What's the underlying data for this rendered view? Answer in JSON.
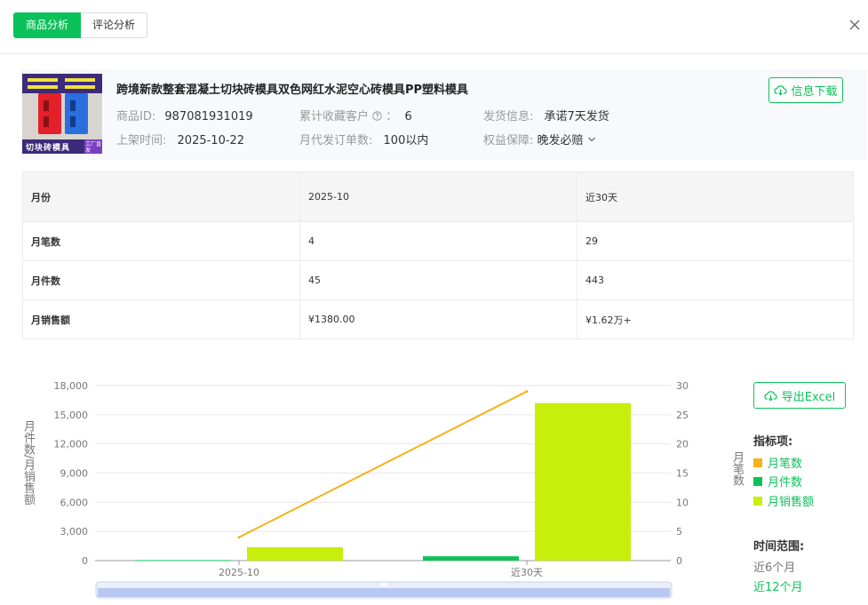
{
  "tabs": [
    {
      "label": "商品分析",
      "active": true
    },
    {
      "label": "评论分析",
      "active": false
    }
  ],
  "product": {
    "title": "跨境新款整套混凝土切块砖模具双色网红水泥空心砖模具PP塑料模具",
    "thumb_label": "切块砖模具",
    "thumb_badge": "工厂直发",
    "id_label": "商品ID:",
    "id_value": "987081931019",
    "fav_label": "累计收藏客户",
    "fav_sep": "：",
    "fav_value": "6",
    "ship_label": "发货信息:",
    "ship_value": "承诺7天发货",
    "listed_label": "上架时间:",
    "listed_value": "2025-10-22",
    "orders_label": "月代发订单数:",
    "orders_value": "100以内",
    "rights_label": "权益保障:",
    "rights_value": "晚发必赔",
    "download_label": "信息下载"
  },
  "table": {
    "header": [
      "月份",
      "2025-10",
      "近30天"
    ],
    "rows": [
      [
        "月笔数",
        "4",
        "29"
      ],
      [
        "月件数",
        "45",
        "443"
      ],
      [
        "月销售额",
        "¥1380.00",
        "¥1.62万+"
      ]
    ]
  },
  "chart_data": {
    "type": "bar",
    "categories": [
      "2025-10",
      "近30天"
    ],
    "series": [
      {
        "name": "月笔数",
        "type": "line",
        "axis": "right",
        "values": [
          4,
          29
        ],
        "color": "#f7b21a"
      },
      {
        "name": "月件数",
        "type": "bar",
        "axis": "left",
        "values": [
          45,
          443
        ],
        "color": "#0bc25a"
      },
      {
        "name": "月销售额",
        "type": "bar",
        "axis": "left",
        "values": [
          1380,
          16200
        ],
        "color": "#c6ef0c"
      }
    ],
    "ylabel": "月件数/月销售额",
    "ylabel_right": "月笔数",
    "ylim": [
      0,
      18000
    ],
    "ylim_right": [
      0,
      30
    ],
    "yticks": [
      "0",
      "3,000",
      "6,000",
      "9,000",
      "12,000",
      "15,000",
      "18,000"
    ],
    "yticks_right": [
      "0",
      "5",
      "10",
      "15",
      "20",
      "25",
      "30"
    ],
    "grid": true
  },
  "side": {
    "export_label": "导出Excel",
    "metrics_title": "指标项:",
    "range_title": "时间范围:",
    "ranges": [
      {
        "label": "近6个月",
        "active": false
      },
      {
        "label": "近12个月",
        "active": true
      }
    ]
  },
  "colors": {
    "accent": "#0bc25a"
  }
}
